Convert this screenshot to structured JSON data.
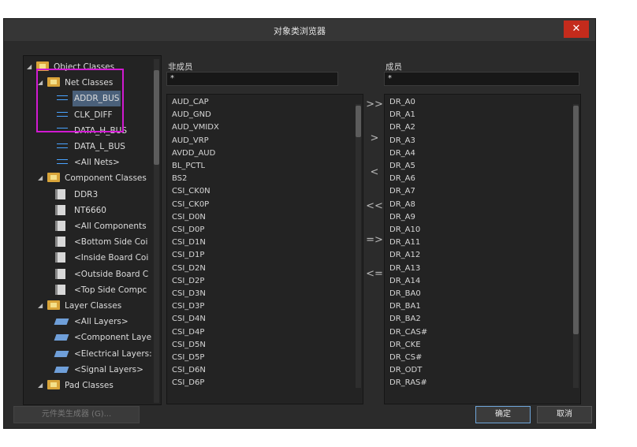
{
  "dialog": {
    "title": "对象类浏览器",
    "close_symbol": "✕"
  },
  "tree": {
    "rows": [
      {
        "label": "Object Classes",
        "toggle": "◢",
        "icon": "folder-icon"
      },
      {
        "label": "Net Classes",
        "toggle": "◢",
        "icon": "folder-icon"
      },
      {
        "label": "ADDR_BUS",
        "icon": "net-class-icon",
        "selected": true
      },
      {
        "label": "CLK_DIFF",
        "icon": "net-class-icon"
      },
      {
        "label": "DATA_H_BUS",
        "icon": "net-class-icon"
      },
      {
        "label": "DATA_L_BUS",
        "icon": "net-class-icon"
      },
      {
        "label": "<All Nets>",
        "icon": "net-class-icon"
      },
      {
        "label": "Component Classes",
        "toggle": "◢",
        "icon": "folder-icon"
      },
      {
        "label": "DDR3",
        "icon": "component-class-icon"
      },
      {
        "label": "NT6660",
        "icon": "component-class-icon"
      },
      {
        "label": "<All Components",
        "icon": "component-class-icon"
      },
      {
        "label": "<Bottom Side Coi",
        "icon": "component-class-icon"
      },
      {
        "label": "<Inside Board Coi",
        "icon": "component-class-icon"
      },
      {
        "label": "<Outside Board C",
        "icon": "component-class-icon"
      },
      {
        "label": "<Top Side Compc",
        "icon": "component-class-icon"
      },
      {
        "label": "Layer Classes",
        "toggle": "◢",
        "icon": "folder-icon"
      },
      {
        "label": "<All Layers>",
        "icon": "layer-class-icon"
      },
      {
        "label": "<Component Laye",
        "icon": "layer-class-icon"
      },
      {
        "label": "<Electrical Layers:",
        "icon": "layer-class-icon"
      },
      {
        "label": "<Signal Layers>",
        "icon": "layer-class-icon"
      },
      {
        "label": "Pad Classes",
        "toggle": "◢",
        "icon": "folder-icon"
      }
    ]
  },
  "non_members": {
    "header": "非成员",
    "filter": "*",
    "items": [
      "AUD_CAP",
      "AUD_GND",
      "AUD_VMIDX",
      "AUD_VRP",
      "AVDD_AUD",
      "BL_PCTL",
      "BS2",
      "CSI_CK0N",
      "CSI_CK0P",
      "CSI_D0N",
      "CSI_D0P",
      "CSI_D1N",
      "CSI_D1P",
      "CSI_D2N",
      "CSI_D2P",
      "CSI_D3N",
      "CSI_D3P",
      "CSI_D4N",
      "CSI_D4P",
      "CSI_D5N",
      "CSI_D5P",
      "CSI_D6N",
      "CSI_D6P"
    ]
  },
  "members": {
    "header": "成员",
    "filter": "*",
    "items": [
      "DR_A0",
      "DR_A1",
      "DR_A2",
      "DR_A3",
      "DR_A4",
      "DR_A5",
      "DR_A6",
      "DR_A7",
      "DR_A8",
      "DR_A9",
      "DR_A10",
      "DR_A11",
      "DR_A12",
      "DR_A13",
      "DR_A14",
      "DR_BA0",
      "DR_BA1",
      "DR_BA2",
      "DR_CAS#",
      "DR_CKE",
      "DR_CS#",
      "DR_ODT",
      "DR_RAS#"
    ]
  },
  "transfer_buttons": [
    ">>",
    ">",
    "<",
    "<<",
    "=>",
    "<="
  ],
  "buttons": {
    "generator": "元件类生成器 (G)...",
    "ok": "确定",
    "cancel": "取消"
  },
  "colors": {
    "highlight_box": "#d11ad1",
    "selection": "#4a607a",
    "close": "#c42b1c"
  }
}
